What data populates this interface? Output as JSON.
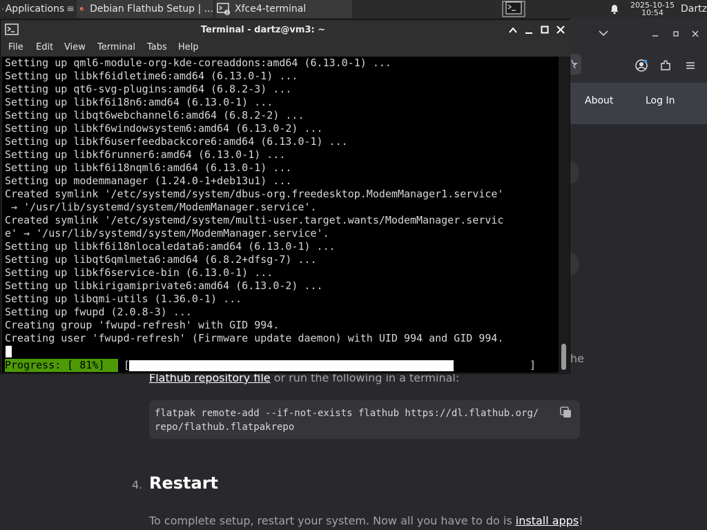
{
  "panel": {
    "apps_label": "Applications",
    "tasks": [
      {
        "label": "Debian Flathub Setup | ...",
        "icon": "firefox-icon"
      },
      {
        "label": "Xfce4-terminal",
        "icon": "terminal-icon",
        "badge": "2"
      }
    ],
    "clock_date": "2025-10-15",
    "clock_time": "10:54",
    "user": "Dartz"
  },
  "browser": {
    "nav_about": "About",
    "nav_login": "Log In",
    "text_fragment_1": "he",
    "link_repo": "Flathub repository file",
    "text_after_link": " or run the following in a terminal:",
    "code_line_1": "flatpak remote-add --if-not-exists flathub https://dl.flathub.org/",
    "code_line_2": "repo/flathub.flatpakrepo",
    "step_number": "4.",
    "step_title": "Restart",
    "restart_text": "To complete setup, restart your system. Now all you have to do is ",
    "install_link": "install apps",
    "restart_text_end": "!"
  },
  "terminal": {
    "title": "Terminal - dartz@vm3: ~",
    "menu": [
      "File",
      "Edit",
      "View",
      "Terminal",
      "Tabs",
      "Help"
    ],
    "lines": [
      "Setting up qml6-module-org-kde-coreaddons:amd64 (6.13.0-1) ...",
      "Setting up libkf6idletime6:amd64 (6.13.0-1) ...",
      "Setting up qt6-svg-plugins:amd64 (6.8.2-3) ...",
      "Setting up libkf6i18n6:amd64 (6.13.0-1) ...",
      "Setting up libqt6webchannel6:amd64 (6.8.2-2) ...",
      "Setting up libkf6windowsystem6:amd64 (6.13.0-2) ...",
      "Setting up libkf6userfeedbackcore6:amd64 (6.13.0-1) ...",
      "Setting up libkf6runner6:amd64 (6.13.0-1) ...",
      "Setting up libkf6i18nqml6:amd64 (6.13.0-1) ...",
      "Setting up modemmanager (1.24.0-1+deb13u1) ...",
      "Created symlink '/etc/systemd/system/dbus-org.freedesktop.ModemManager1.service'",
      " → '/usr/lib/systemd/system/ModemManager.service'.",
      "Created symlink '/etc/systemd/system/multi-user.target.wants/ModemManager.servic",
      "e' → '/usr/lib/systemd/system/ModemManager.service'.",
      "Setting up libkf6i18nlocaledata6:amd64 (6.13.0-1) ...",
      "Setting up libqt6qmlmeta6:amd64 (6.8.2+dfsg-7) ...",
      "Setting up libkf6service-bin (6.13.0-1) ...",
      "Setting up libkirigamiprivate6:amd64 (6.13.0-2) ...",
      "Setting up libqmi-utils (1.36.0-1) ...",
      "Setting up fwupd (2.0.8-3) ...",
      "Creating group 'fwupd-refresh' with GID 994.",
      "Creating user 'fwupd-refresh' (Firmware update daemon) with UID 994 and GID 994."
    ],
    "progress_label": "Progress: [ 81%]",
    "progress_open": "[",
    "progress_close": "]",
    "progress_fraction": 0.81
  },
  "colors": {
    "progress_green": "#4e9a06",
    "terminal_bg": "#000000",
    "page_bg": "#29292d"
  }
}
